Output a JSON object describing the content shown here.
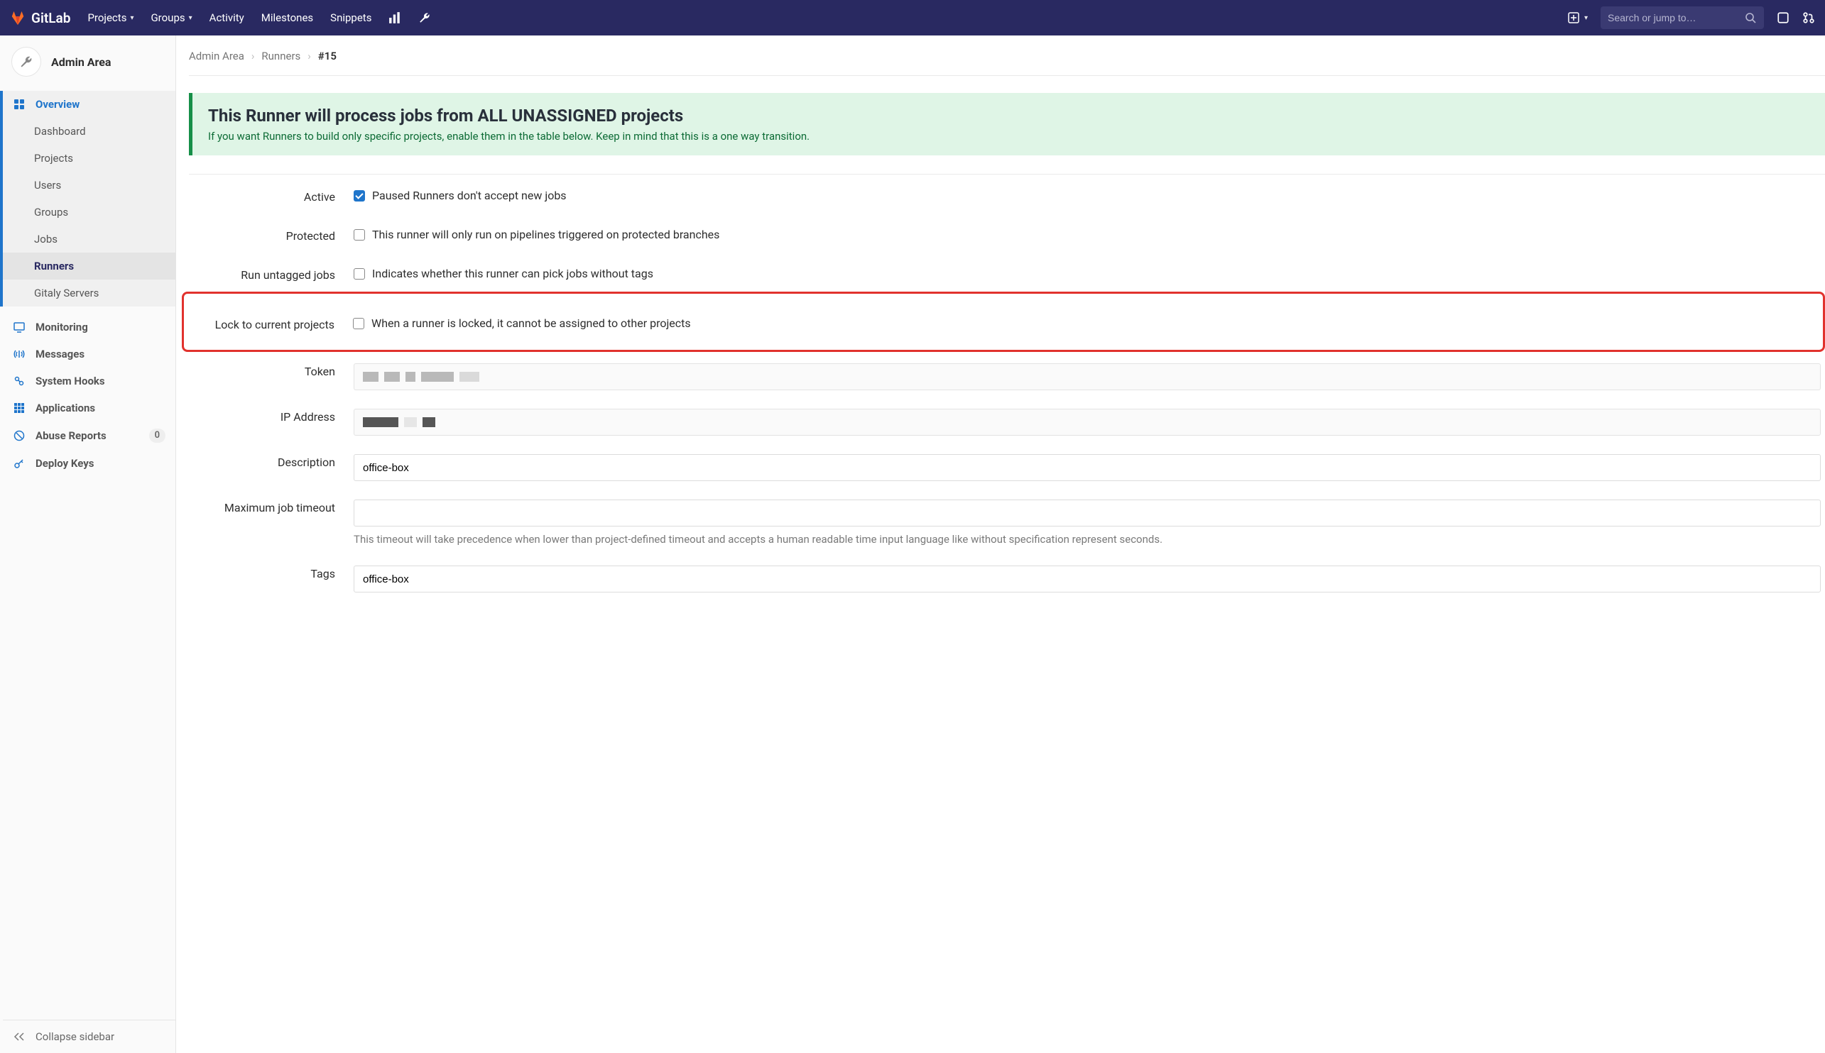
{
  "brand": "GitLab",
  "topnav": {
    "projects": "Projects",
    "groups": "Groups",
    "activity": "Activity",
    "milestones": "Milestones",
    "snippets": "Snippets"
  },
  "search": {
    "placeholder": "Search or jump to…"
  },
  "sidebar": {
    "title": "Admin Area",
    "overview_label": "Overview",
    "overview_items": {
      "dashboard": "Dashboard",
      "projects": "Projects",
      "users": "Users",
      "groups": "Groups",
      "jobs": "Jobs",
      "runners": "Runners",
      "gitaly": "Gitaly Servers"
    },
    "items": {
      "monitoring": "Monitoring",
      "messages": "Messages",
      "system_hooks": "System Hooks",
      "applications": "Applications",
      "abuse_reports": "Abuse Reports",
      "abuse_count": "0",
      "deploy_keys": "Deploy Keys"
    },
    "collapse": "Collapse sidebar"
  },
  "breadcrumbs": {
    "admin": "Admin Area",
    "runners": "Runners",
    "id": "#15"
  },
  "notice": {
    "title": "This Runner will process jobs from ALL UNASSIGNED projects",
    "body": "If you want Runners to build only specific projects, enable them in the table below. Keep in mind that this is a one way transition."
  },
  "form": {
    "active": {
      "label": "Active",
      "help": "Paused Runners don't accept new jobs",
      "checked": true
    },
    "protected": {
      "label": "Protected",
      "help": "This runner will only run on pipelines triggered on protected branches",
      "checked": false
    },
    "untagged": {
      "label": "Run untagged jobs",
      "help": "Indicates whether this runner can pick jobs without tags",
      "checked": false
    },
    "lock": {
      "label": "Lock to current projects",
      "help": "When a runner is locked, it cannot be assigned to other projects",
      "checked": false
    },
    "token": {
      "label": "Token"
    },
    "ip": {
      "label": "IP Address"
    },
    "description": {
      "label": "Description",
      "value": "office-box"
    },
    "timeout": {
      "label": "Maximum job timeout",
      "value": "",
      "help": "This timeout will take precedence when lower than project-defined timeout and accepts a human readable time input language like without specification represent seconds."
    },
    "tags": {
      "label": "Tags",
      "value": "office-box"
    }
  }
}
